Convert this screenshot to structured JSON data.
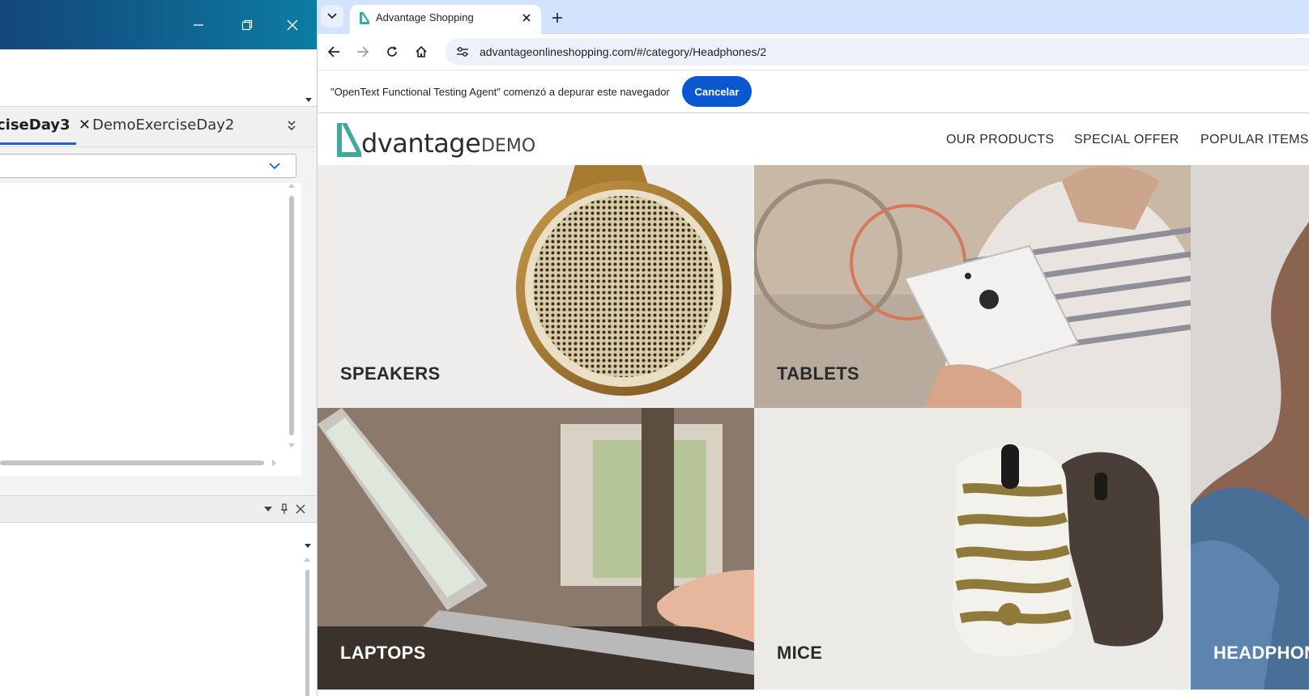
{
  "ide": {
    "tabs": [
      {
        "label": "ciseDay3",
        "active": true
      },
      {
        "label": "DemoExerciseDay2",
        "active": false
      }
    ],
    "tab_close_glyph": "✕"
  },
  "browser": {
    "tab": {
      "title": "Advantage Shopping"
    },
    "url": "advantageonlineshopping.com/#/category/Headphones/2",
    "infobar": {
      "message": "\"OpenText Functional Testing Agent\" comenzó a depurar este navegador",
      "cancel_label": "Cancelar"
    },
    "accent_color": "#0b57d0"
  },
  "site": {
    "logo_word": "dvantage",
    "logo_suffix": "DEMO",
    "logo_color": "#3fa9a0",
    "nav": [
      "OUR PRODUCTS",
      "SPECIAL OFFER",
      "POPULAR ITEMS"
    ],
    "categories": [
      {
        "label": "SPEAKERS"
      },
      {
        "label": "TABLETS"
      },
      {
        "label": "LAPTOPS"
      },
      {
        "label": "MICE"
      },
      {
        "label": "HEADPHON"
      }
    ]
  }
}
